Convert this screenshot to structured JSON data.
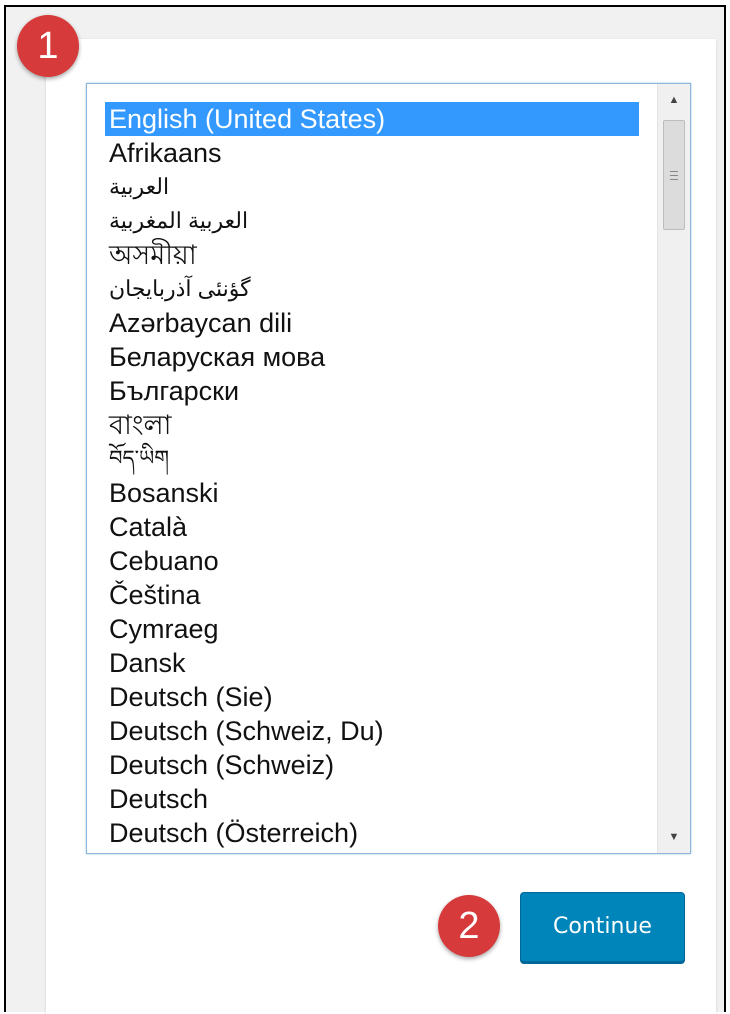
{
  "language_select": {
    "selected": "English (United States)",
    "options": [
      "English (United States)",
      "Afrikaans",
      "العربية",
      "العربية المغربية",
      "অসমীয়া",
      "گؤنئی آذربایجان",
      "Azərbaycan dili",
      "Беларуская мова",
      "Български",
      "বাংলা",
      "བོད་ཡིག",
      "Bosanski",
      "Català",
      "Cebuano",
      "Čeština",
      "Cymraeg",
      "Dansk",
      "Deutsch (Sie)",
      "Deutsch (Schweiz, Du)",
      "Deutsch (Schweiz)",
      "Deutsch",
      "Deutsch (Österreich)"
    ]
  },
  "badges": {
    "step1": "1",
    "step2": "2"
  },
  "continue_button": {
    "label": "Continue"
  },
  "colors": {
    "primary": "#0085ba",
    "badge": "#d63a3a",
    "selection": "#3399ff"
  }
}
